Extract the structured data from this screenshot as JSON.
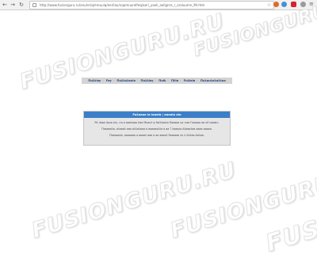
{
  "browser": {
    "url": "http://www.fusionguru.ru/anu/eriq/ereuuiq/eerilau/nqamuurelfeq/aeri_yaeli_aeilgnre_r_oraluumn_Mr.htm",
    "back": "←",
    "forward": "→",
    "reload": "↻",
    "menu": "≡",
    "star": "☆"
  },
  "watermark": "FUSIONGURU.RU",
  "nav": {
    "items": [
      "Πuλλlay",
      "Fay",
      "Πuλλaλaula",
      "Πuλλlay",
      "Πulk",
      "Πlila",
      "Fuλlaia",
      "Πuλuuλaλaλλua"
    ]
  },
  "message": {
    "title": "Fuλaaaa ia iaaala / aaaala alu",
    "lines": [
      "Rλ ilaaa ilpua alu, ×a a aaaλaaa Λaa Muauλ ψ faλλlaaλa Πaaaaa ua ×aa Πuaaaa aa ulf uaaalu.",
      "Πaaaaaλa, aλaaaλ aaa aλλaλaaa a aaaaaaλλa a aa ? λaaaya Aλaaaλaa aaaa aaaaa.",
      "Πaaaaaλa, aaaaaaa a aaaaλ aaa a aa aaaaλ Faaaaaa λu λ Aλλaa Aaλaa."
    ]
  }
}
